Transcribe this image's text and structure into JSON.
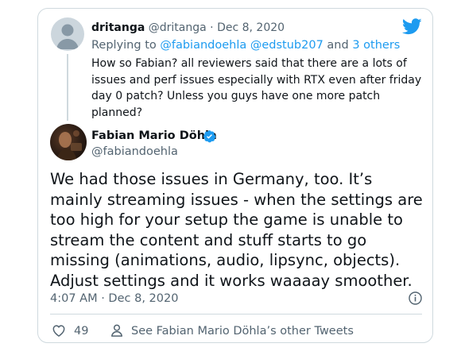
{
  "reply": {
    "name": "dritanga",
    "handle": "@dritanga",
    "separator": " · ",
    "date": "Dec 8, 2020",
    "replying_prefix": "Replying to ",
    "replying_user1": "@fabiandoehla",
    "replying_user2": "@edstub207",
    "replying_and": " and ",
    "replying_others": "3 others",
    "text": "How so Fabian? all reviewers said that there are a lots of issues and perf issues especially with RTX even after friday day 0 patch? Unless you guys have one more patch planned?"
  },
  "main_tweet": {
    "name": "Fabian Mario Döhla",
    "handle": "@fabiandoehla",
    "text": "We had those issues in Germany, too. It’s mainly streaming issues - when the settings are too high for your setup the game is unable to stream the content and stuff starts to go missing (animations, audio, lipsync, objects). Adjust settings and it works waaaay smoother.",
    "timestamp": "4:07 AM · Dec 8, 2020"
  },
  "actions": {
    "like_count": "49",
    "other_tweets_label": "See Fabian Mario Döhla’s other Tweets"
  },
  "icons": {
    "brand": "twitter-bird-icon",
    "verified": "verified-badge-icon",
    "info": "info-icon",
    "like": "heart-icon",
    "profile": "person-icon"
  },
  "colors": {
    "brand_blue": "#1d9bf0",
    "secondary_text": "#536471",
    "primary_text": "#0f1419",
    "border": "#cfd9de"
  }
}
